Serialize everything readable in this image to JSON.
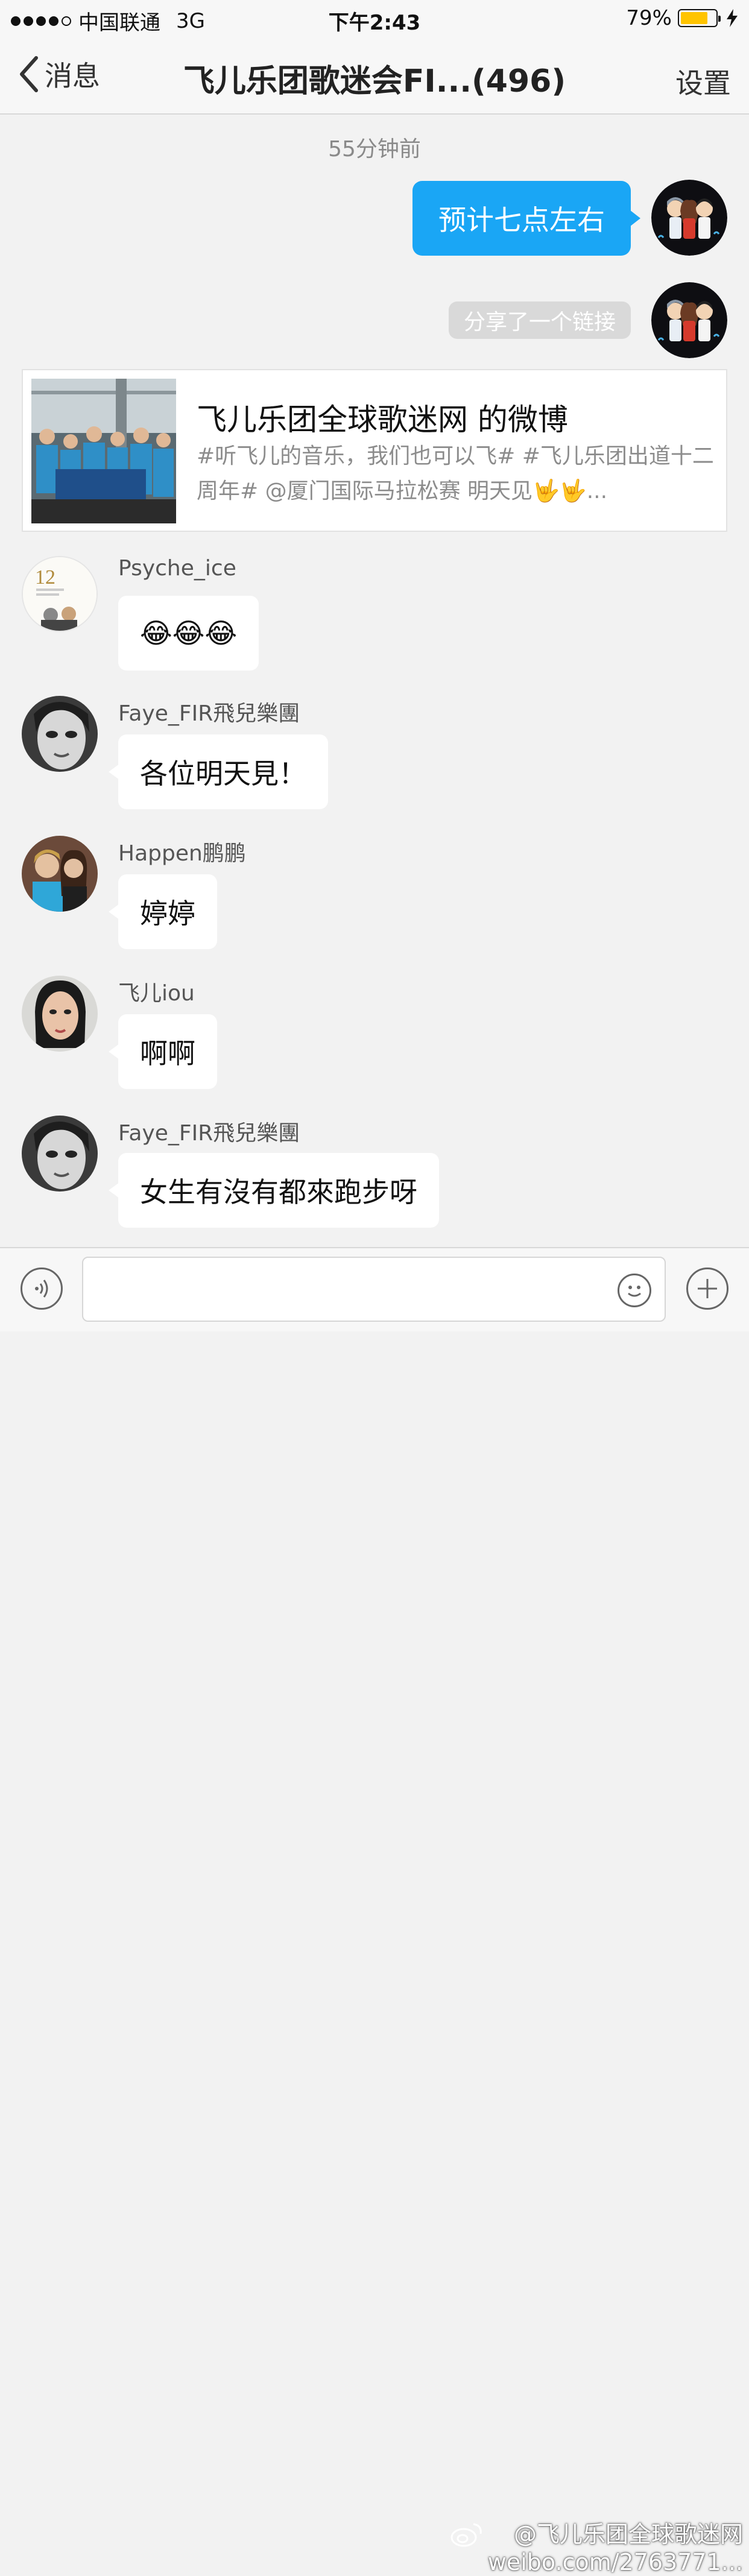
{
  "status_bar": {
    "carrier": "中国联通",
    "network": "3G",
    "time": "下午2:43",
    "battery": "79%",
    "battery_level": 0.79
  },
  "nav": {
    "back_label": "消息",
    "title": "飞儿乐团歌迷会FI...(496)",
    "settings_label": "设置"
  },
  "chat": {
    "timestamp": "55分钟前",
    "outgoing_text": "预计七点左右",
    "shared_notice": "分享了一个链接",
    "link_card": {
      "title": "飞儿乐团全球歌迷网 的微博",
      "description": "#听飞儿的音乐，我们也可以飞# #飞儿乐团出道十二周年# @厦门国际马拉松赛 明天见🤟🤟..."
    },
    "messages": [
      {
        "sender": "Psyche_ice",
        "text": "😂😂😂"
      },
      {
        "sender": "Faye_FIR飛兒樂團",
        "text": "各位明天見！"
      },
      {
        "sender": "Happen鹏鹏",
        "text": "婷婷"
      },
      {
        "sender": "飞儿iou",
        "text": "啊啊"
      },
      {
        "sender": "Faye_FIR飛兒樂團",
        "text": "女生有沒有都來跑步呀"
      }
    ]
  },
  "watermark": {
    "line1": "@飞儿乐团全球歌迷网",
    "line2": "weibo.com/2763771..."
  },
  "colors": {
    "accent": "#1aa6f5",
    "background": "#f2f2f2",
    "battery": "#ffc400"
  }
}
